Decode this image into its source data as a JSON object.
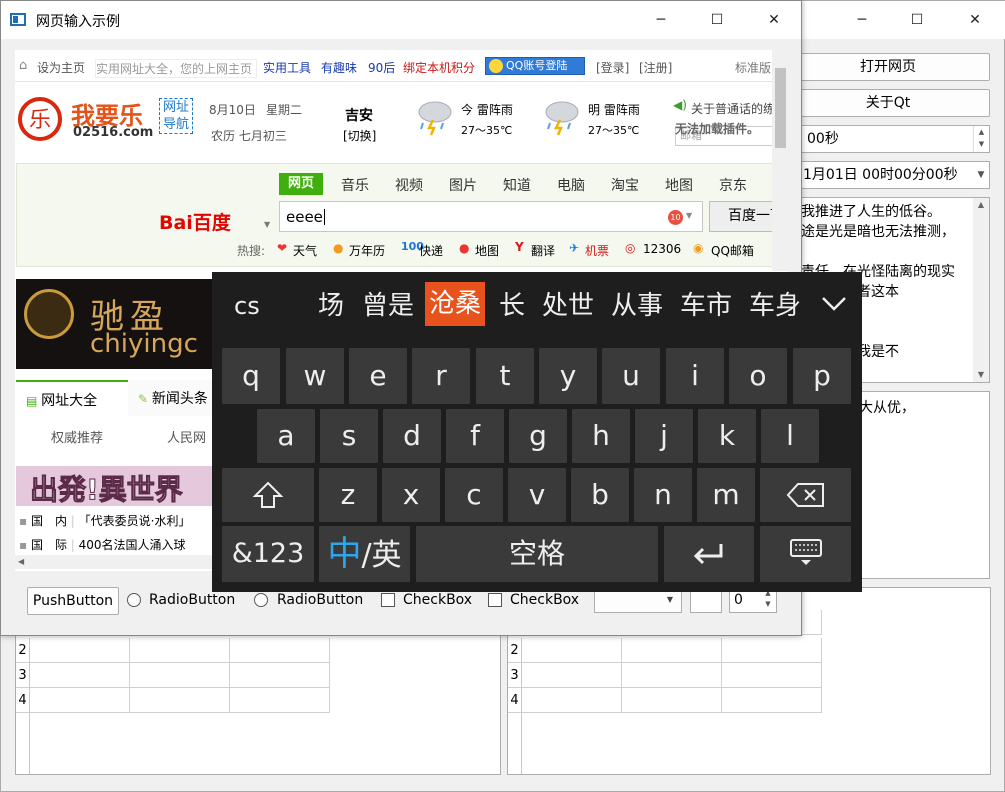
{
  "main_window": {
    "buttons": [
      "打开网页",
      "关于Qt"
    ],
    "spin_value": "00秒",
    "datetime_value": "1月01日 00时00分00秒",
    "text_lines": [
      "我推进了人生的低谷。",
      "途是光是暗也无法推测，",
      "",
      "责任，在光怪陆离的现实",
      "一梦，或者这本",
      "",
      "",
      "度怀疑过我是不"
    ],
    "text2": "无欺，量大从优，",
    "table_rows": [
      "2",
      "3",
      "4"
    ]
  },
  "dialog": {
    "title": "网页输入示例",
    "controls": {
      "push_button": "PushButton",
      "radio1": "RadioButton",
      "radio2": "RadioButton",
      "check1": "CheckBox",
      "check2": "CheckBox",
      "spin_value": "0"
    }
  },
  "web": {
    "top_links": [
      "设为主页",
      "实用网址大全，您的上网主页",
      "实用工具",
      "有趣味",
      "90后",
      "绑定本机积分",
      "QQ账号登陆",
      "[登录]",
      "[注册]",
      "标准版"
    ],
    "logo_text": "我要乐",
    "logo_domain": "02516.com",
    "logo_tag1": "网址",
    "logo_tag2": "导航",
    "date": "8月10日",
    "weekday": "星期二",
    "lunar": "农历 七月初三",
    "city": "吉安",
    "city_switch": "[切换]",
    "today_label": "今 雷阵雨",
    "today_temp": "27～35℃",
    "tomorrow_label": "明 雷阵雨",
    "tomorrow_temp": "27～35℃",
    "notice": "关于普通话的练",
    "plugin_warning": "无法加载插件。",
    "mail_placeholder": "邮箱",
    "search_tabs": [
      "网页",
      "音乐",
      "视频",
      "图片",
      "知道",
      "电脑",
      "淘宝",
      "地图",
      "京东"
    ],
    "baidu_logo": "Bai百度",
    "search_value": "eeee",
    "search_badge": "10",
    "search_button": "百度一下",
    "hot_label": "热搜:",
    "hot_items": [
      "天气",
      "万年历",
      "快递",
      "地图",
      "翻译",
      "机票",
      "12306",
      "QQ邮箱"
    ],
    "banner_title": "驰盈",
    "banner_domain": "chiyingc",
    "section_tabs": [
      "网址大全",
      "新闻头条"
    ],
    "sub_links": [
      "权威推荐",
      "人民网"
    ],
    "promo_text": "出発!異世界",
    "news": [
      {
        "cat": "国　内",
        "text": "「代表委员说·水利」"
      },
      {
        "cat": "国　际",
        "text": "400名法国人涌入球"
      }
    ]
  },
  "keyboard": {
    "composition": "cs",
    "candidates": [
      "场",
      "曾是",
      "沧桑",
      "长",
      "处世",
      "从事",
      "车市",
      "车身"
    ],
    "selected_candidate": "沧桑",
    "row1": [
      "q",
      "w",
      "e",
      "r",
      "t",
      "y",
      "u",
      "i",
      "o",
      "p"
    ],
    "row2": [
      "a",
      "s",
      "d",
      "f",
      "g",
      "h",
      "j",
      "k",
      "l"
    ],
    "row3": [
      "z",
      "x",
      "c",
      "v",
      "b",
      "n",
      "m"
    ],
    "num_key": "&123",
    "lang_zh": "中",
    "lang_sep": "/英",
    "space": "空格"
  },
  "colors": {
    "candidate_highlight": "#e8521d",
    "baidu_red": "#e10601",
    "baidu_blue": "#2932e1",
    "search_tab_green": "#3eaf0e"
  }
}
